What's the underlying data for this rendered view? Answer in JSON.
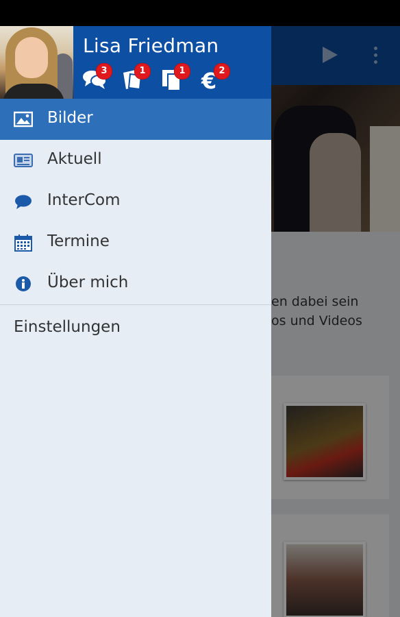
{
  "background": {
    "text_lines": [
      "en dabei sein",
      "os und Videos"
    ]
  },
  "drawer": {
    "user_name": "Lisa Friedman",
    "badges": [
      {
        "icon": "chat-bubbles-icon",
        "count": "3"
      },
      {
        "icon": "ticket-icon",
        "count": "1"
      },
      {
        "icon": "documents-icon",
        "count": "1"
      },
      {
        "icon": "euro-icon",
        "count": "2"
      }
    ],
    "menu": [
      {
        "label": "Bilder",
        "icon": "image-icon",
        "active": true
      },
      {
        "label": "Aktuell",
        "icon": "newspaper-icon",
        "active": false
      },
      {
        "label": "InterCom",
        "icon": "chat-bubble-icon",
        "active": false
      },
      {
        "label": "Termine",
        "icon": "calendar-icon",
        "active": false
      },
      {
        "label": "Über mich",
        "icon": "info-icon",
        "active": false
      }
    ],
    "settings_label": "Einstellungen"
  },
  "colors": {
    "header_blue": "#0d4fa3",
    "active_item": "#2d6fb8",
    "drawer_bg": "#e6edf5",
    "badge_red": "#e0191f",
    "icon_blue": "#1a5aa8"
  }
}
